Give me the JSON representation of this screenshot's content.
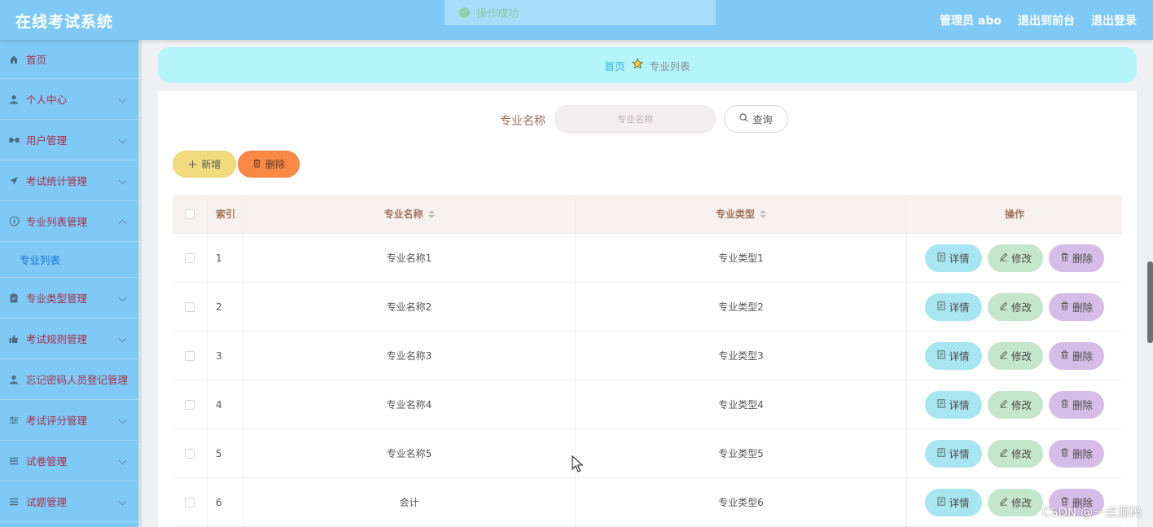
{
  "header": {
    "title": "在线考试系统",
    "admin": "管理员 abo",
    "to_front": "退出到前台",
    "logout": "退出登录"
  },
  "toast": {
    "message": "操作成功"
  },
  "sidebar": {
    "items": [
      {
        "label": "首页",
        "icon": "home-icon"
      },
      {
        "label": "个人中心",
        "icon": "user-icon"
      },
      {
        "label": "用户管理",
        "icon": "users-icon"
      },
      {
        "label": "考试统计管理",
        "icon": "send-icon"
      },
      {
        "label": "专业列表管理",
        "icon": "compass-icon"
      },
      {
        "label": "专业列表",
        "icon": ""
      },
      {
        "label": "专业类型管理",
        "icon": "clipboard-icon"
      },
      {
        "label": "考试规则管理",
        "icon": "thumb-icon"
      },
      {
        "label": "忘记密码人员登记管理",
        "icon": "person-icon"
      },
      {
        "label": "考试评分管理",
        "icon": "sliders-icon"
      },
      {
        "label": "试卷管理",
        "icon": "menu-icon"
      },
      {
        "label": "试题管理",
        "icon": "menu-icon"
      }
    ]
  },
  "breadcrumb": {
    "home": "首页",
    "current": "专业列表"
  },
  "search": {
    "label": "专业名称",
    "placeholder": "专业名称",
    "button": "查询"
  },
  "actions": {
    "add": "新增",
    "delete": "删除"
  },
  "table": {
    "headers": {
      "index": "索引",
      "name": "专业名称",
      "type": "专业类型",
      "op": "操作"
    },
    "rows": [
      {
        "index": "1",
        "name": "专业名称1",
        "type": "专业类型1"
      },
      {
        "index": "2",
        "name": "专业名称2",
        "type": "专业类型2"
      },
      {
        "index": "3",
        "name": "专业名称3",
        "type": "专业类型3"
      },
      {
        "index": "4",
        "name": "专业名称4",
        "type": "专业类型4"
      },
      {
        "index": "5",
        "name": "专业名称5",
        "type": "专业类型5"
      },
      {
        "index": "6",
        "name": "会计",
        "type": "专业类型6"
      }
    ],
    "row_actions": {
      "detail": "详情",
      "edit": "修改",
      "delete": "删除"
    }
  },
  "watermark": "CSDN @一点源码",
  "colors": {
    "header": "#7ec9f6",
    "sidebar_text": "#a9304a",
    "active": "#1d6fd6",
    "breadcrumb_bg": "#b4f4fb"
  }
}
